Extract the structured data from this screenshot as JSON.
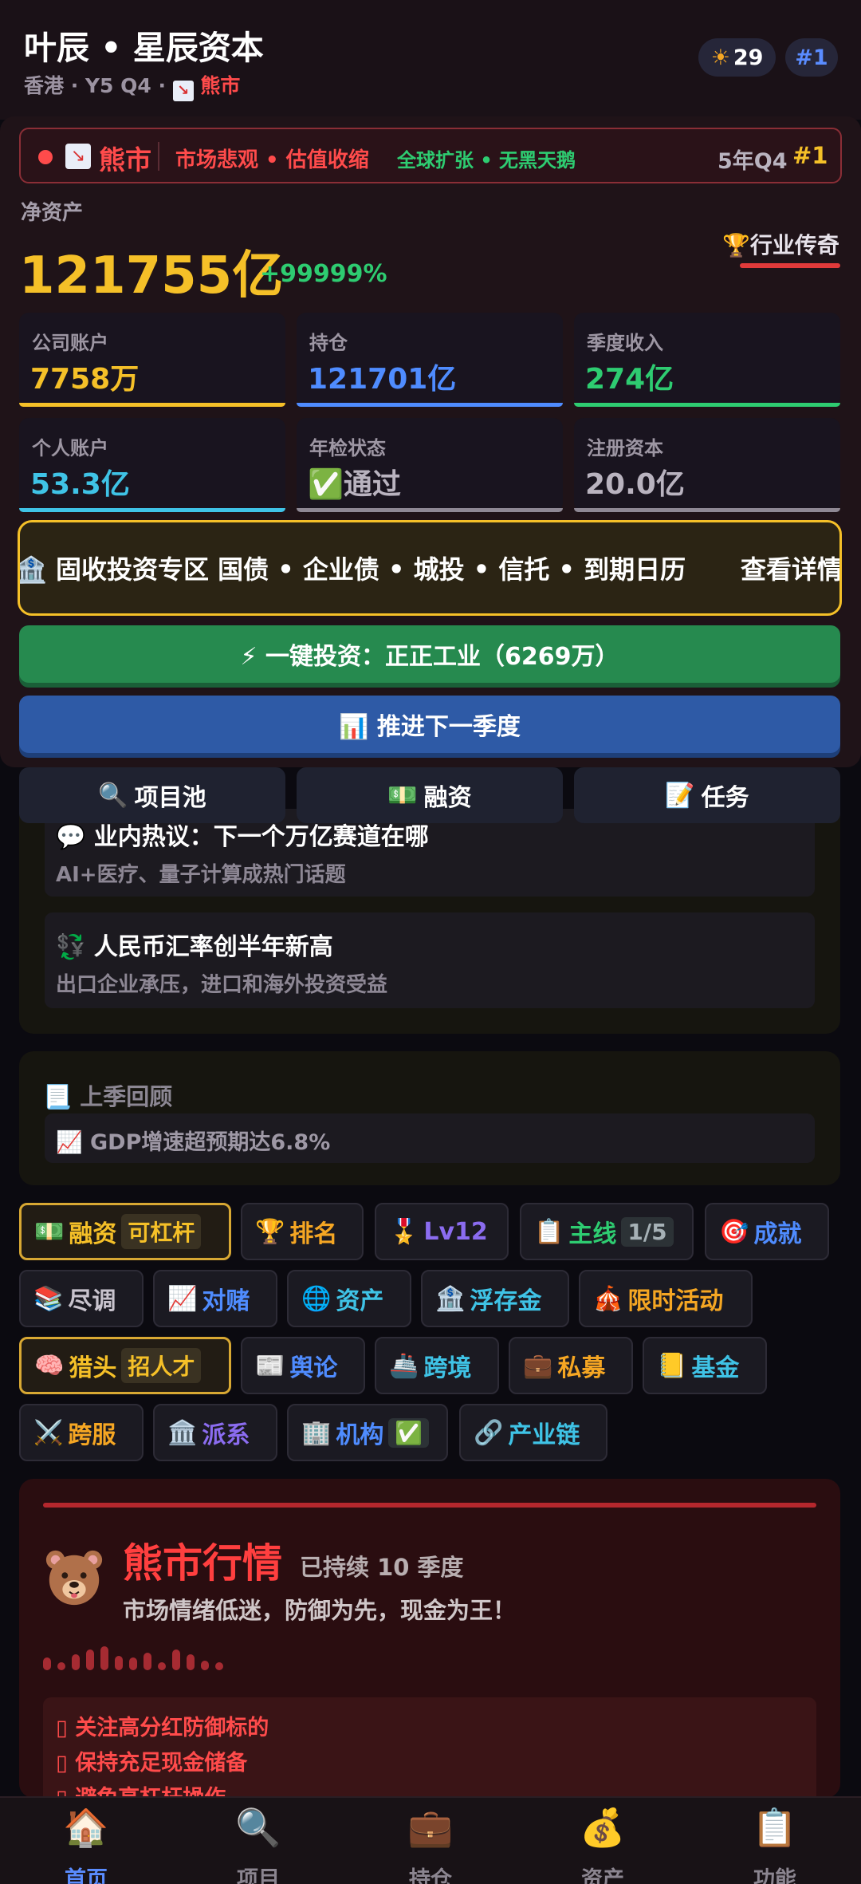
{
  "header": {
    "title": "叶辰 • 星辰资本",
    "subtitle_prefix": "香港 · Y5 Q4 · ",
    "subtitle_market_icon": "chart-down-icon",
    "subtitle_market": "熊市",
    "sun_icon": "sun-icon",
    "sun_value": "29",
    "rank": "#1"
  },
  "market": {
    "status_icon": "chart-down-icon",
    "label": "熊市",
    "sentiment": "市场悲观 • 估值收缩",
    "global": "全球扩张 • 无黑天鹅",
    "quarter": "5年Q4",
    "rank": "#1",
    "colors": {
      "bear": "#ff4b4b",
      "global": "#2ecc71",
      "rank": "#f5c028"
    }
  },
  "net_worth": {
    "label": "净资产",
    "value": "121755亿",
    "change": "+99999%",
    "title_icon": "trophy-icon",
    "title": "行业传奇"
  },
  "stats": [
    {
      "label": "公司账户",
      "value": "7758万",
      "color": "#f5c028"
    },
    {
      "label": "持仓",
      "value": "121701亿",
      "color": "#4f8cff"
    },
    {
      "label": "季度收入",
      "value": "274亿",
      "color": "#2ecc71"
    },
    {
      "label": "个人账户",
      "value": "53.3亿",
      "color": "#3fc3e6"
    },
    {
      "label": "年检状态",
      "value": "✅通过",
      "color": "#b9b3bf"
    },
    {
      "label": "注册资本",
      "value": "20.0亿",
      "color": "#b9b3bf"
    }
  ],
  "fixed_income": {
    "text": "🏦 固收投资专区 国债 • 企业债 • 城投 • 信托 • 到期日历",
    "more": "查看详情"
  },
  "actions": {
    "invest": "⚡ 一键投资：正正工业（6269万）",
    "advance": "📊 推进下一季度"
  },
  "tabs": [
    {
      "icon": "🔍",
      "label": "项目池"
    },
    {
      "icon": "💵",
      "label": "融资"
    },
    {
      "icon": "📝",
      "label": "任务"
    }
  ],
  "news": [
    {
      "title": "💬 业内热议：下一个万亿赛道在哪",
      "desc": "AI+医疗、量子计算成热门话题"
    },
    {
      "title": "💱 人民币汇率创半年新高",
      "desc": "出口企业承压，进口和海外投资受益"
    }
  ],
  "review": {
    "title": "📃 上季回顾",
    "items": [
      "📈 GDP增速超预期达6.8%"
    ]
  },
  "chips": [
    {
      "icon": "💵",
      "label": "融资",
      "tag": "可杠杆",
      "color": "#f5c028"
    },
    {
      "icon": "🏆",
      "label": "排名",
      "color": "#f5a623"
    },
    {
      "icon": "🎖️",
      "label": "Lv12",
      "color": "#8b6cf0"
    },
    {
      "icon": "📋",
      "label": "主线",
      "tag": "1/5",
      "color": "#2ecc71"
    },
    {
      "icon": "🎯",
      "label": "成就",
      "color": "#4f8cff"
    },
    {
      "icon": "📚",
      "label": "尽调",
      "color": "#c9c4ce"
    },
    {
      "icon": "📈",
      "label": "对赌",
      "color": "#4f8cff"
    },
    {
      "icon": "🌐",
      "label": "资产",
      "color": "#3fc3e6"
    },
    {
      "icon": "🏦",
      "label": "浮存金",
      "color": "#3fc3e6"
    },
    {
      "icon": "🎪",
      "label": "限时活动",
      "color": "#f5a623"
    },
    {
      "icon": "🧠",
      "label": "猎头",
      "tag": "招人才",
      "color": "#f5c028"
    },
    {
      "icon": "📰",
      "label": "舆论",
      "color": "#4f8cff"
    },
    {
      "icon": "🚢",
      "label": "跨境",
      "color": "#3fc3e6"
    },
    {
      "icon": "💼",
      "label": "私募",
      "color": "#f5a623"
    },
    {
      "icon": "📒",
      "label": "基金",
      "color": "#3fc3e6"
    },
    {
      "icon": "⚔️",
      "label": "跨服",
      "color": "#f5a623"
    },
    {
      "icon": "🏛️",
      "label": "派系",
      "color": "#8b6cf0"
    },
    {
      "icon": "🏢",
      "label": "机构",
      "tag": "✅",
      "color": "#4f8cff"
    },
    {
      "icon": "🔗",
      "label": "产业链",
      "color": "#3fc3e6"
    }
  ],
  "bear": {
    "icon": "bear-icon",
    "title": "熊市行情",
    "duration": "已持续 10 季度",
    "desc": "市场情绪低迷，防御为先，现金为王！",
    "tips": [
      "▯ 关注高分红防御标的",
      "▯ 保持充足现金储备",
      "▯ 避免高杠杆操作"
    ]
  },
  "nav": [
    {
      "icon": "🏠",
      "label": "首页"
    },
    {
      "icon": "🔍",
      "label": "项目"
    },
    {
      "icon": "💼",
      "label": "持仓"
    },
    {
      "icon": "💰",
      "label": "资产"
    },
    {
      "icon": "📋",
      "label": "功能"
    }
  ]
}
